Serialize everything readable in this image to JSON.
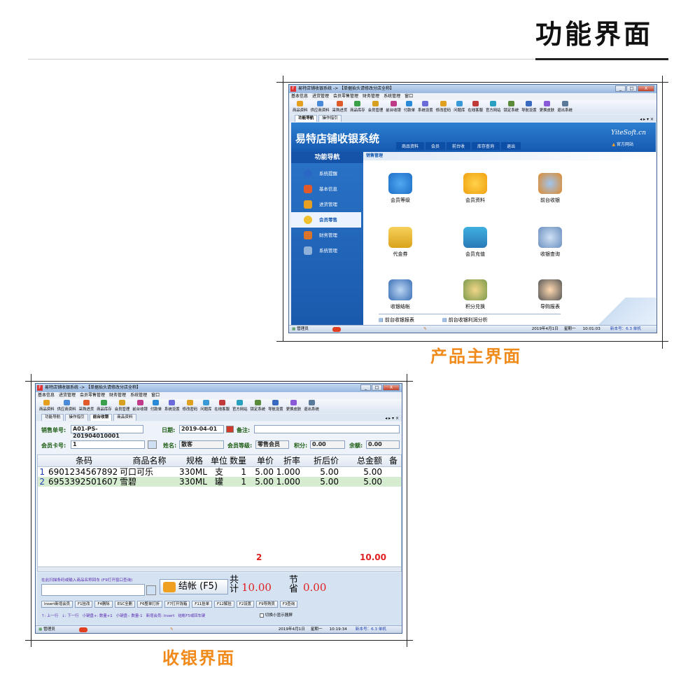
{
  "page_title": "功能界面",
  "captions": {
    "main": "产品主界面",
    "pos": "收银界面"
  },
  "app": {
    "logo_letter": "F",
    "window_title": "易特店铺收银系统 -> 【单据抬头请修改分店全称】",
    "menu": [
      "基本信息",
      "进货管理",
      "会员零售管理",
      "财务管理",
      "系统管理",
      "窗口"
    ],
    "toolbar": [
      "商品资料",
      "供应商资料",
      "采购进货",
      "商品库存",
      "会员管理",
      "前台收银",
      "付款单",
      "系统设置",
      "修改密码",
      "问题库",
      "在线客服",
      "官方网站",
      "锁定系统",
      "导航设置",
      "更换皮肤",
      "退出系统"
    ],
    "controls": {
      "minimize": "_",
      "maximize": "□",
      "close": "X"
    }
  },
  "main_screen": {
    "tabs": [
      "功能导航",
      "操作指引"
    ],
    "tab_controls": "◂ ▸ ▾ ×",
    "banner_title": "易特店铺收银系统",
    "banner_site": "YiteSoft.cn",
    "banner_home": "官方网站",
    "banner_tabs": [
      "商品资料",
      "会员",
      "前台收",
      "库存查询",
      "退出"
    ],
    "nav_header": "功能导航",
    "nav_items": [
      "系统提醒",
      "基本信息",
      "进货管理",
      "会员零售",
      "财务管理",
      "系统管理"
    ],
    "section_label": "销售管理",
    "grid_items": [
      "会员等级",
      "会员资料",
      "前台收银",
      "代金券",
      "会员充值",
      "收银查询",
      "收银结帐",
      "积分兑换",
      "导购报表"
    ],
    "reports": [
      "前台收银报表",
      "前台收银利润分析"
    ],
    "status": {
      "user": "管理员",
      "date": "2019年4月1日",
      "weekday": "星期一",
      "time": "10:01:03",
      "version": "新本号：6.3 单机"
    }
  },
  "pos_screen": {
    "tabs": [
      "功能导航",
      "操作指引",
      "前台收银",
      "商品资料"
    ],
    "tab_controls": "◂ ▸ ▾ ×",
    "bill_label": "销售单号:",
    "bill_no": "A01-PS-201904010001",
    "date_label": "日期:",
    "date": "2019-04-01",
    "remark_label": "备注:",
    "card_label": "会员卡号:",
    "card_no": "1",
    "name_label": "姓名:",
    "name": "散客",
    "level_label": "会员等级:",
    "level": "零售会员",
    "points_label": "积分:",
    "points": "0.00",
    "balance_label": "余额:",
    "balance": "0.00",
    "columns": [
      "条码",
      "商品名称",
      "规格",
      "单位",
      "数量",
      "单价",
      "折率",
      "折后价",
      "总金额",
      "备"
    ],
    "rows": [
      {
        "no": "1",
        "barcode": "6901234567892",
        "name": "可口可乐",
        "spec": "330ML",
        "unit": "支",
        "qty": "1",
        "price": "5.00",
        "rate": "1.000",
        "disc": "5.00",
        "total": "5.00"
      },
      {
        "no": "2",
        "barcode": "6953392501607",
        "name": "雪碧",
        "spec": "330ML",
        "unit": "罐",
        "qty": "1",
        "price": "5.00",
        "rate": "1.000",
        "disc": "5.00",
        "total": "5.00"
      }
    ],
    "sum_qty": "2",
    "sum_total": "10.00",
    "scan_hint": "在此扫描条码或输入商品名称回车 (F9打开窗口查询)",
    "checkout": "结帐 (F5)",
    "total_label": "共计",
    "total_value": "10.00",
    "save_label": "节省",
    "save_value": "0.00",
    "hotkeys": [
      "Insert新增会员",
      "F1挂改",
      "F4删除",
      "ESC全删",
      "F6整单打折",
      "F7打开钱箱",
      "F11挂单",
      "F12解挂",
      "F2设置",
      "F9导购员",
      "F3查询"
    ],
    "tips": "↑: 上一行   ↓: 下一行   小键盘+: 数量+1   小键盘-: 数量-1   新增会员: Insert   结帐F5或回车键",
    "toggle": "切换小显示器屏",
    "status": {
      "user": "管理员",
      "date": "2019年4月1日",
      "weekday": "星期一",
      "time": "10:19:34",
      "version": "新本号：6.3 单机"
    }
  },
  "colors": {
    "caption": "#f08a1a",
    "accent": "#1559b0",
    "red": "#e02020"
  }
}
